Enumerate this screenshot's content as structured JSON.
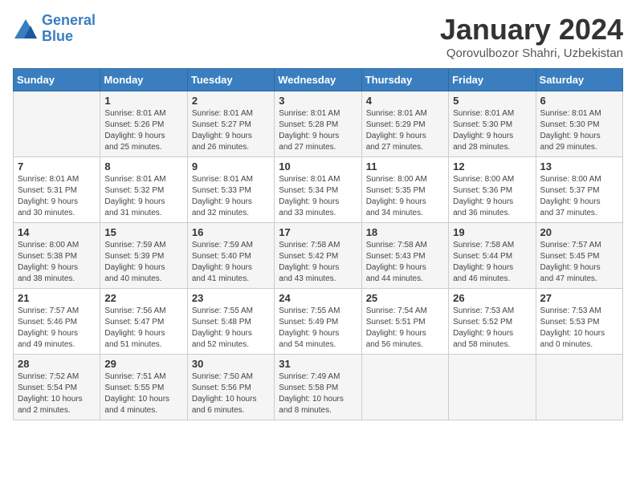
{
  "header": {
    "logo_line1": "General",
    "logo_line2": "Blue",
    "month": "January 2024",
    "location": "Qorovulbozor Shahri, Uzbekistan"
  },
  "weekdays": [
    "Sunday",
    "Monday",
    "Tuesday",
    "Wednesday",
    "Thursday",
    "Friday",
    "Saturday"
  ],
  "weeks": [
    [
      {
        "day": "",
        "text": ""
      },
      {
        "day": "1",
        "text": "Sunrise: 8:01 AM\nSunset: 5:26 PM\nDaylight: 9 hours\nand 25 minutes."
      },
      {
        "day": "2",
        "text": "Sunrise: 8:01 AM\nSunset: 5:27 PM\nDaylight: 9 hours\nand 26 minutes."
      },
      {
        "day": "3",
        "text": "Sunrise: 8:01 AM\nSunset: 5:28 PM\nDaylight: 9 hours\nand 27 minutes."
      },
      {
        "day": "4",
        "text": "Sunrise: 8:01 AM\nSunset: 5:29 PM\nDaylight: 9 hours\nand 27 minutes."
      },
      {
        "day": "5",
        "text": "Sunrise: 8:01 AM\nSunset: 5:30 PM\nDaylight: 9 hours\nand 28 minutes."
      },
      {
        "day": "6",
        "text": "Sunrise: 8:01 AM\nSunset: 5:30 PM\nDaylight: 9 hours\nand 29 minutes."
      }
    ],
    [
      {
        "day": "7",
        "text": "Sunrise: 8:01 AM\nSunset: 5:31 PM\nDaylight: 9 hours\nand 30 minutes."
      },
      {
        "day": "8",
        "text": "Sunrise: 8:01 AM\nSunset: 5:32 PM\nDaylight: 9 hours\nand 31 minutes."
      },
      {
        "day": "9",
        "text": "Sunrise: 8:01 AM\nSunset: 5:33 PM\nDaylight: 9 hours\nand 32 minutes."
      },
      {
        "day": "10",
        "text": "Sunrise: 8:01 AM\nSunset: 5:34 PM\nDaylight: 9 hours\nand 33 minutes."
      },
      {
        "day": "11",
        "text": "Sunrise: 8:00 AM\nSunset: 5:35 PM\nDaylight: 9 hours\nand 34 minutes."
      },
      {
        "day": "12",
        "text": "Sunrise: 8:00 AM\nSunset: 5:36 PM\nDaylight: 9 hours\nand 36 minutes."
      },
      {
        "day": "13",
        "text": "Sunrise: 8:00 AM\nSunset: 5:37 PM\nDaylight: 9 hours\nand 37 minutes."
      }
    ],
    [
      {
        "day": "14",
        "text": "Sunrise: 8:00 AM\nSunset: 5:38 PM\nDaylight: 9 hours\nand 38 minutes."
      },
      {
        "day": "15",
        "text": "Sunrise: 7:59 AM\nSunset: 5:39 PM\nDaylight: 9 hours\nand 40 minutes."
      },
      {
        "day": "16",
        "text": "Sunrise: 7:59 AM\nSunset: 5:40 PM\nDaylight: 9 hours\nand 41 minutes."
      },
      {
        "day": "17",
        "text": "Sunrise: 7:58 AM\nSunset: 5:42 PM\nDaylight: 9 hours\nand 43 minutes."
      },
      {
        "day": "18",
        "text": "Sunrise: 7:58 AM\nSunset: 5:43 PM\nDaylight: 9 hours\nand 44 minutes."
      },
      {
        "day": "19",
        "text": "Sunrise: 7:58 AM\nSunset: 5:44 PM\nDaylight: 9 hours\nand 46 minutes."
      },
      {
        "day": "20",
        "text": "Sunrise: 7:57 AM\nSunset: 5:45 PM\nDaylight: 9 hours\nand 47 minutes."
      }
    ],
    [
      {
        "day": "21",
        "text": "Sunrise: 7:57 AM\nSunset: 5:46 PM\nDaylight: 9 hours\nand 49 minutes."
      },
      {
        "day": "22",
        "text": "Sunrise: 7:56 AM\nSunset: 5:47 PM\nDaylight: 9 hours\nand 51 minutes."
      },
      {
        "day": "23",
        "text": "Sunrise: 7:55 AM\nSunset: 5:48 PM\nDaylight: 9 hours\nand 52 minutes."
      },
      {
        "day": "24",
        "text": "Sunrise: 7:55 AM\nSunset: 5:49 PM\nDaylight: 9 hours\nand 54 minutes."
      },
      {
        "day": "25",
        "text": "Sunrise: 7:54 AM\nSunset: 5:51 PM\nDaylight: 9 hours\nand 56 minutes."
      },
      {
        "day": "26",
        "text": "Sunrise: 7:53 AM\nSunset: 5:52 PM\nDaylight: 9 hours\nand 58 minutes."
      },
      {
        "day": "27",
        "text": "Sunrise: 7:53 AM\nSunset: 5:53 PM\nDaylight: 10 hours\nand 0 minutes."
      }
    ],
    [
      {
        "day": "28",
        "text": "Sunrise: 7:52 AM\nSunset: 5:54 PM\nDaylight: 10 hours\nand 2 minutes."
      },
      {
        "day": "29",
        "text": "Sunrise: 7:51 AM\nSunset: 5:55 PM\nDaylight: 10 hours\nand 4 minutes."
      },
      {
        "day": "30",
        "text": "Sunrise: 7:50 AM\nSunset: 5:56 PM\nDaylight: 10 hours\nand 6 minutes."
      },
      {
        "day": "31",
        "text": "Sunrise: 7:49 AM\nSunset: 5:58 PM\nDaylight: 10 hours\nand 8 minutes."
      },
      {
        "day": "",
        "text": ""
      },
      {
        "day": "",
        "text": ""
      },
      {
        "day": "",
        "text": ""
      }
    ]
  ]
}
